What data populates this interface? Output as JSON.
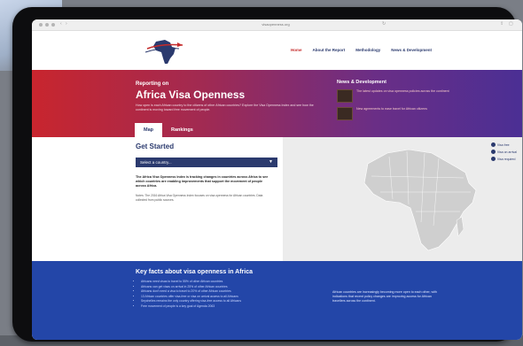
{
  "browser": {
    "url": "visaopenness.org"
  },
  "nav": {
    "links": [
      "Home",
      "About the Report",
      "Methodology",
      "News & Development"
    ]
  },
  "hero": {
    "pre_title": "Reporting on",
    "title": "Africa Visa Openness",
    "description": "How open is each African country to the citizens of other African countries? Explore the Visa Openness Index and see how the continent is moving toward free movement of people.",
    "news_heading": "News & Development",
    "news_items": [
      "The latest updates on visa openness policies across the continent",
      "New agreements to ease travel for African citizens"
    ],
    "tabs": [
      "Map",
      "Rankings"
    ]
  },
  "main": {
    "heading": "Get Started",
    "select_placeholder": "Select a country...",
    "intro": "The Africa Visa Openness Index is tracking changes in countries across Africa to see which countries are enabling improvements that support the movement of people across Africa.",
    "note": "Notes: The 2016 Africa Visa Openness Index focuses on visa openness for African countries. Data collected from public sources.",
    "legend": [
      "Visa free",
      "Visa on arrival",
      "Visa required"
    ]
  },
  "footer": {
    "heading": "Key facts about visa openness in Africa",
    "facts": [
      "Africans need visas to travel to 55% of other African countries",
      "Africans can get visas on arrival in 25% of other African countries",
      "Africans don't need a visa to travel to 20% of other African countries",
      "13 African countries offer visa-free or visa on arrival access to all Africans",
      "Seychelles remains the only country offering visa-free access to all Africans",
      "Free movement of people is a key goal of Agenda 2063"
    ],
    "aside": "African countries are increasingly becoming more open to each other, with indications that recent policy changes are improving access for African travellers across the continent."
  }
}
